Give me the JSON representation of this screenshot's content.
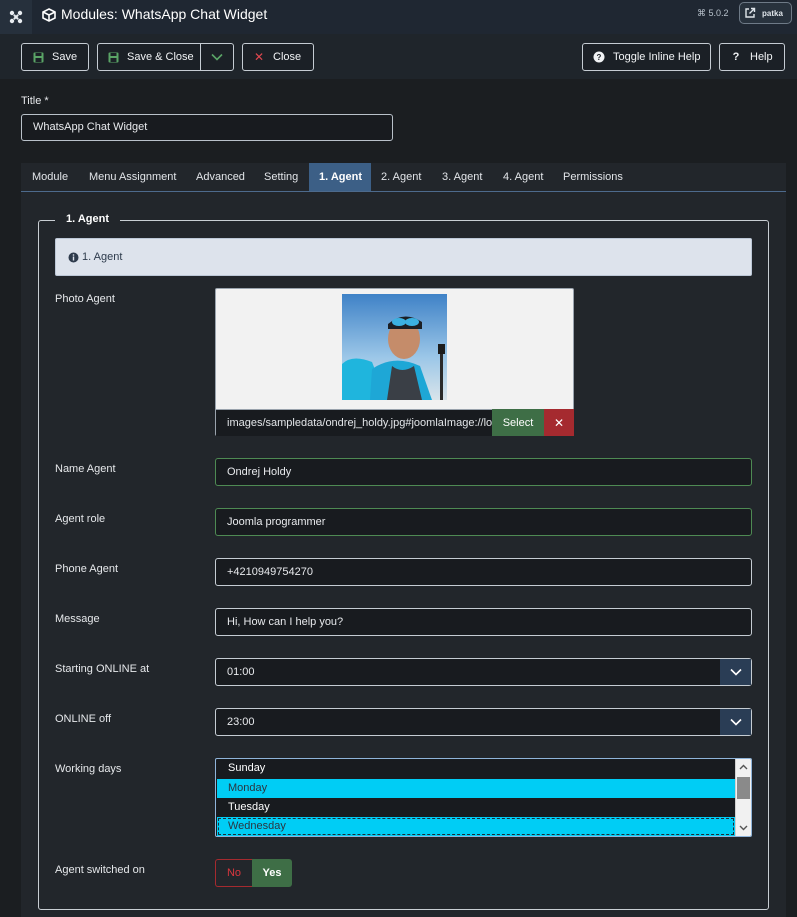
{
  "header": {
    "title": "Modules: WhatsApp Chat Widget",
    "version": "5.0.2",
    "user_label": "patka"
  },
  "toolbar": {
    "save_label": "Save",
    "save_close_label": "Save & Close",
    "close_label": "Close",
    "toggle_help_label": "Toggle Inline Help",
    "help_label": "Help"
  },
  "form": {
    "title_label": "Title *",
    "title_value": "WhatsApp Chat Widget"
  },
  "tabs": [
    {
      "label": "Module"
    },
    {
      "label": "Menu Assignment"
    },
    {
      "label": "Advanced"
    },
    {
      "label": "Setting"
    },
    {
      "label": "1. Agent"
    },
    {
      "label": "2. Agent"
    },
    {
      "label": "3. Agent"
    },
    {
      "label": "4. Agent"
    },
    {
      "label": "Permissions"
    }
  ],
  "agent": {
    "legend": "1. Agent",
    "info_text": "1. Agent",
    "photo_label": "Photo Agent",
    "photo_path": "images/sampledata/ondrej_holdy.jpg#joomlaImage://local-images/sampledata/ondrej_holdy.jpg",
    "select_label": "Select",
    "clear_label": "✕",
    "name_label": "Name Agent",
    "name_value": "Ondrej Holdy",
    "role_label": "Agent role",
    "role_value": "Joomla programmer",
    "phone_label": "Phone Agent",
    "phone_value": "+4210949754270",
    "message_label": "Message",
    "message_value": "Hi, How can I help you?",
    "start_label": "Starting ONLINE at",
    "start_value": "01:00",
    "off_label": "ONLINE off",
    "off_value": "23:00",
    "days_label": "Working days",
    "days": [
      {
        "label": "Sunday",
        "selected": false
      },
      {
        "label": "Monday",
        "selected": true
      },
      {
        "label": "Tuesday",
        "selected": false
      },
      {
        "label": "Wednesday",
        "selected": true
      }
    ],
    "switch_label": "Agent switched on",
    "switch_no": "No",
    "switch_yes": "Yes"
  },
  "colors": {
    "accent_tab": "#3c5f86",
    "success": "#3e6e46",
    "danger": "#a52a2f",
    "selected_option": "#00cdf5"
  }
}
